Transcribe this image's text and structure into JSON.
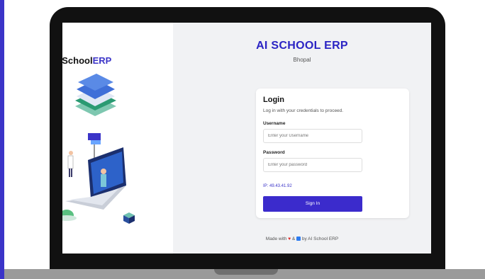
{
  "brand": {
    "logo_text_prefix": "#School",
    "logo_text_highlight": "ERP"
  },
  "header": {
    "title": "AI SCHOOL ERP",
    "subtitle": "Bhopal"
  },
  "login": {
    "title": "Login",
    "subtitle": "Log in with your credentials to proceed.",
    "username_label": "Username",
    "username_placeholder": "Enter your Username",
    "password_label": "Password",
    "password_placeholder": "Enter your password",
    "ip_text": "IP: 49.43.41.92",
    "sign_in_label": "Sign In"
  },
  "footer": {
    "prefix": "Made with",
    "heart_glyph": "♥",
    "ampersand": "&",
    "suffix": "by AI School ERP"
  },
  "colors": {
    "accent": "#3b2bcc",
    "title": "#2b24c4",
    "heart": "#e02626",
    "book": "#2d7cf0"
  }
}
